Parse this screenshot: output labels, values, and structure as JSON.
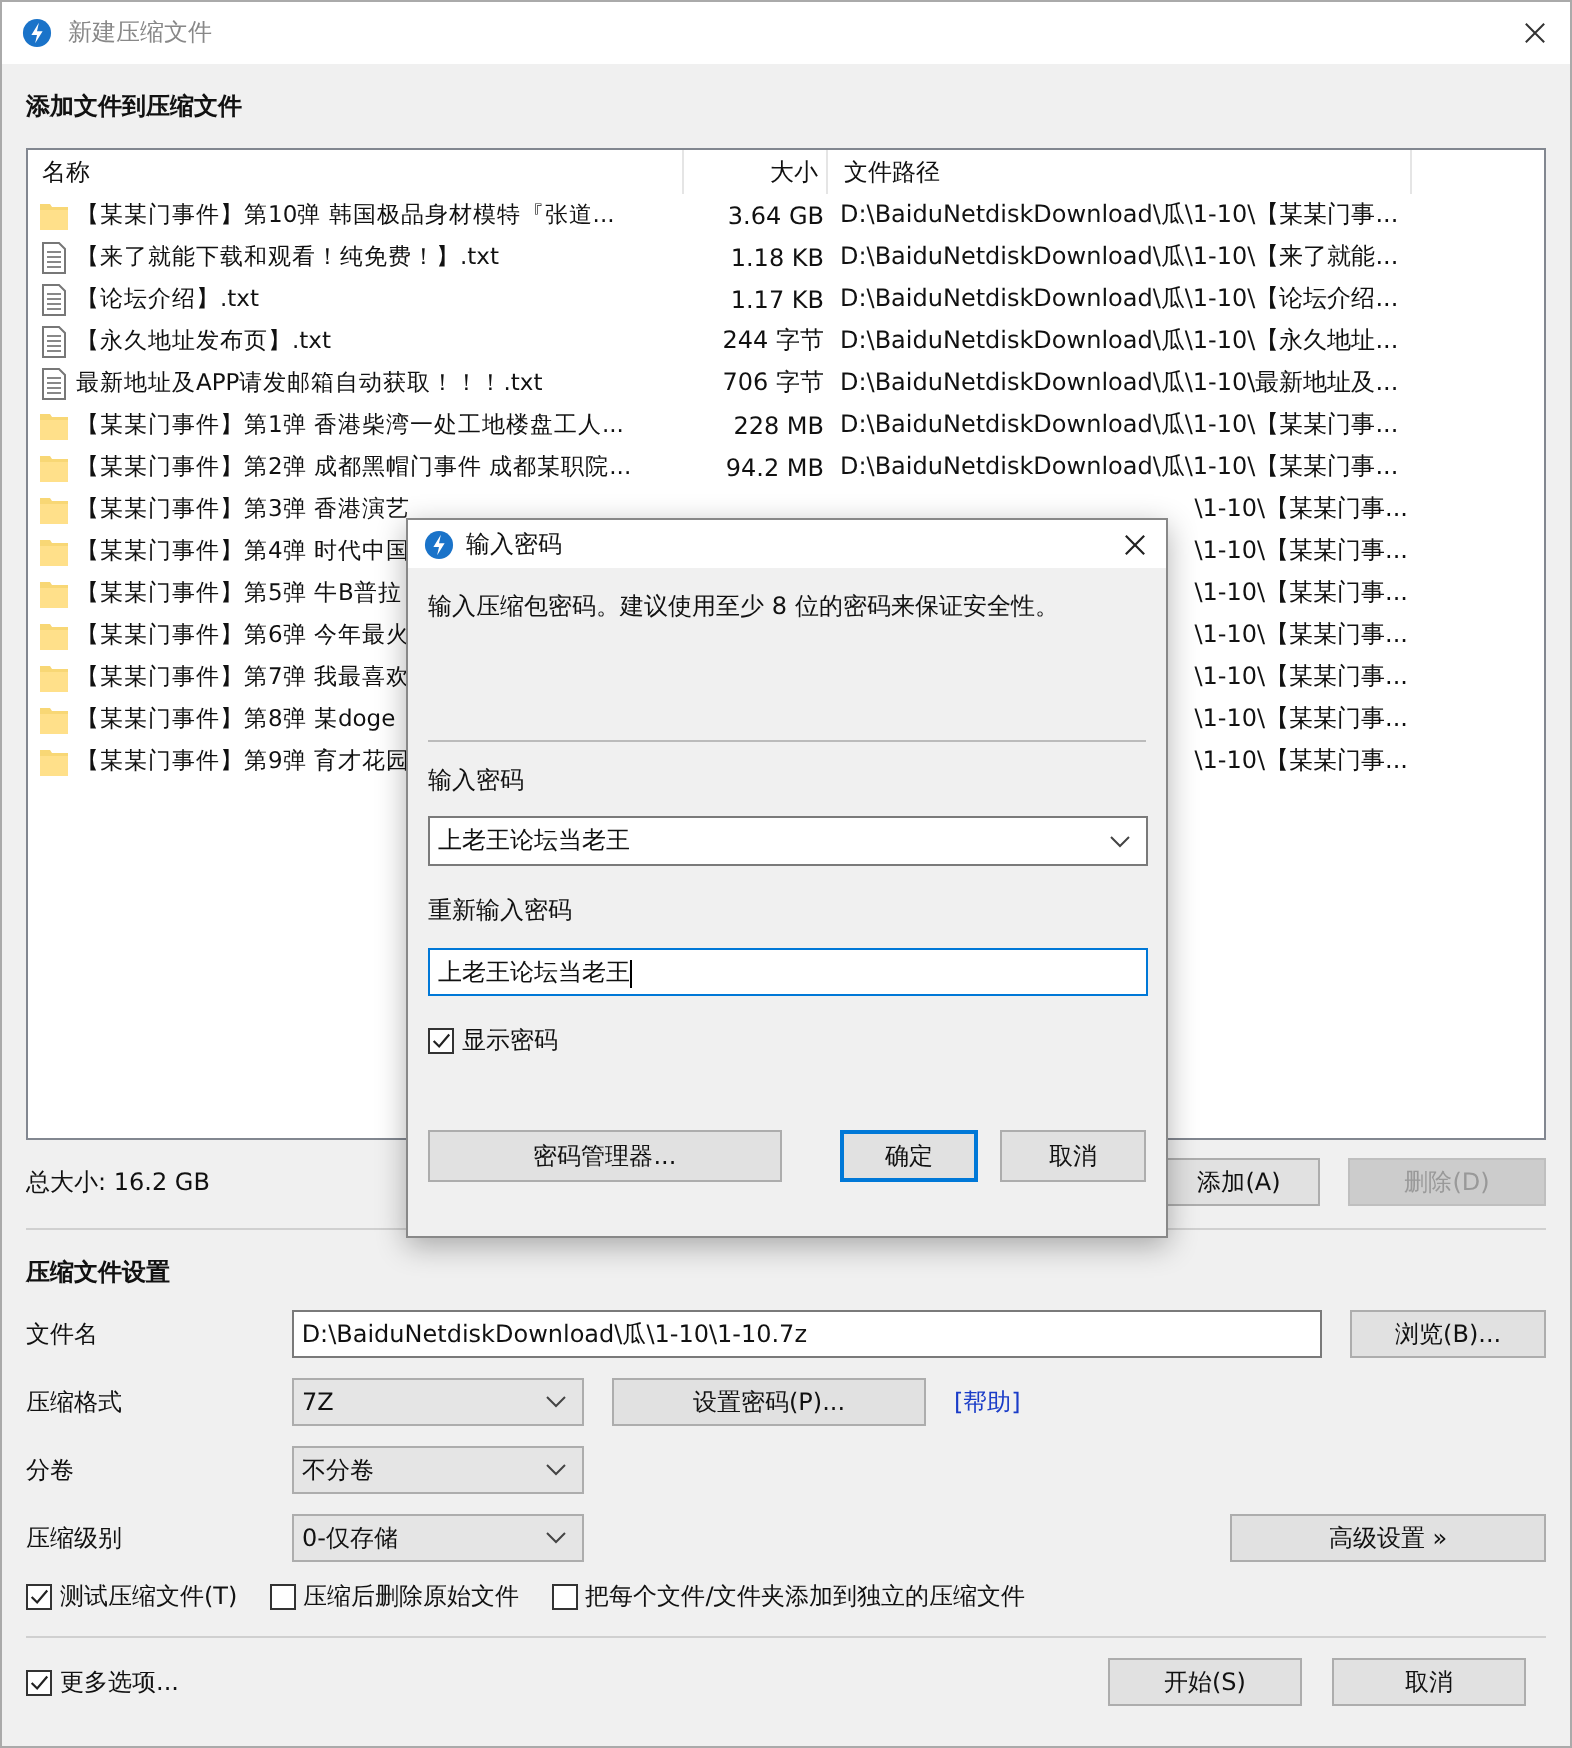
{
  "window": {
    "title": "新建压缩文件"
  },
  "files_section": {
    "title": "添加文件到压缩文件",
    "columns": [
      "名称",
      "大小",
      "文件路径"
    ],
    "rows": [
      {
        "kind": "folder",
        "name": "【某某门事件】第10弹 韩国极品身材模特『张道...",
        "size": "3.64 GB",
        "path": "D:\\BaiduNetdiskDownload\\瓜\\1-10\\【某某门事..."
      },
      {
        "kind": "text",
        "name": "【来了就能下载和观看！纯免费！】.txt",
        "size": "1.18 KB",
        "path": "D:\\BaiduNetdiskDownload\\瓜\\1-10\\【来了就能..."
      },
      {
        "kind": "text",
        "name": "【论坛介绍】.txt",
        "size": "1.17 KB",
        "path": "D:\\BaiduNetdiskDownload\\瓜\\1-10\\【论坛介绍..."
      },
      {
        "kind": "text",
        "name": "【永久地址发布页】.txt",
        "size": "244 字节",
        "path": "D:\\BaiduNetdiskDownload\\瓜\\1-10\\【永久地址..."
      },
      {
        "kind": "text",
        "name": "最新地址及APP请发邮箱自动获取！！！.txt",
        "size": "706 字节",
        "path": "D:\\BaiduNetdiskDownload\\瓜\\1-10\\最新地址及..."
      },
      {
        "kind": "folder",
        "name": "【某某门事件】第1弹 香港柴湾一处工地楼盘工人...",
        "size": "228 MB",
        "path": "D:\\BaiduNetdiskDownload\\瓜\\1-10\\【某某门事..."
      },
      {
        "kind": "folder",
        "name": "【某某门事件】第2弹 成都黑帽门事件 成都某职院...",
        "size": "94.2 MB",
        "path": "D:\\BaiduNetdiskDownload\\瓜\\1-10\\【某某门事..."
      },
      {
        "kind": "folder",
        "name": "【某某门事件】第3弹 香港演艺",
        "path": "\\1-10\\【某某门事..."
      },
      {
        "kind": "folder",
        "name": "【某某门事件】第4弹 时代中国",
        "path": "\\1-10\\【某某门事..."
      },
      {
        "kind": "folder",
        "name": "【某某门事件】第5弹 牛B普拉",
        "path": "\\1-10\\【某某门事..."
      },
      {
        "kind": "folder",
        "name": "【某某门事件】第6弹 今年最火",
        "path": "\\1-10\\【某某门事..."
      },
      {
        "kind": "folder",
        "name": "【某某门事件】第7弹 我最喜欢",
        "path": "\\1-10\\【某某门事..."
      },
      {
        "kind": "folder",
        "name": "【某某门事件】第8弹 某doge",
        "path": "\\1-10\\【某某门事..."
      },
      {
        "kind": "folder",
        "name": "【某某门事件】第9弹 育才花园",
        "path": "\\1-10\\【某某门事..."
      }
    ],
    "total": "总大小: 16.2 GB",
    "buttons": [
      {
        "label": "添加(A)",
        "disabled": false
      },
      {
        "label": "删除(D)",
        "disabled": true
      }
    ]
  },
  "settings": {
    "title": "压缩文件设置",
    "filename": {
      "label": "文件名",
      "value": "D:\\BaiduNetdiskDownload\\瓜\\1-10\\1-10.7z",
      "button": "浏览(B)..."
    },
    "format": {
      "label": "压缩格式",
      "value": "7Z",
      "button": "设置密码(P)...",
      "link": "[帮助]"
    },
    "volume": {
      "label": "分卷",
      "value": "不分卷"
    },
    "level": {
      "label": "压缩级别",
      "value": "0-仅存储",
      "button": "高级设置 »"
    },
    "options": [
      {
        "label": "测试压缩文件(T)",
        "checked": true
      },
      {
        "label": "压缩后删除原始文件",
        "checked": false
      },
      {
        "label": "把每个文件/文件夹添加到独立的压缩文件",
        "checked": false
      }
    ]
  },
  "footer": {
    "more_options": {
      "label": "更多选项...",
      "checked": true
    },
    "buttons": [
      "开始(S)",
      "取消"
    ]
  },
  "dialog": {
    "title": "输入密码",
    "description": "输入压缩包密码。建议使用至少 8 位的密码来保证安全性。",
    "password_label": "输入密码",
    "password": "上老王论坛当老王",
    "confirm_label": "重新输入密码",
    "confirm": "上老王论坛当老王",
    "show_password": {
      "label": "显示密码",
      "checked": true
    },
    "buttons": [
      {
        "label": "密码管理器...",
        "kind": "manager"
      },
      {
        "label": "确定",
        "kind": "default"
      },
      {
        "label": "取消",
        "kind": "normal"
      }
    ]
  }
}
